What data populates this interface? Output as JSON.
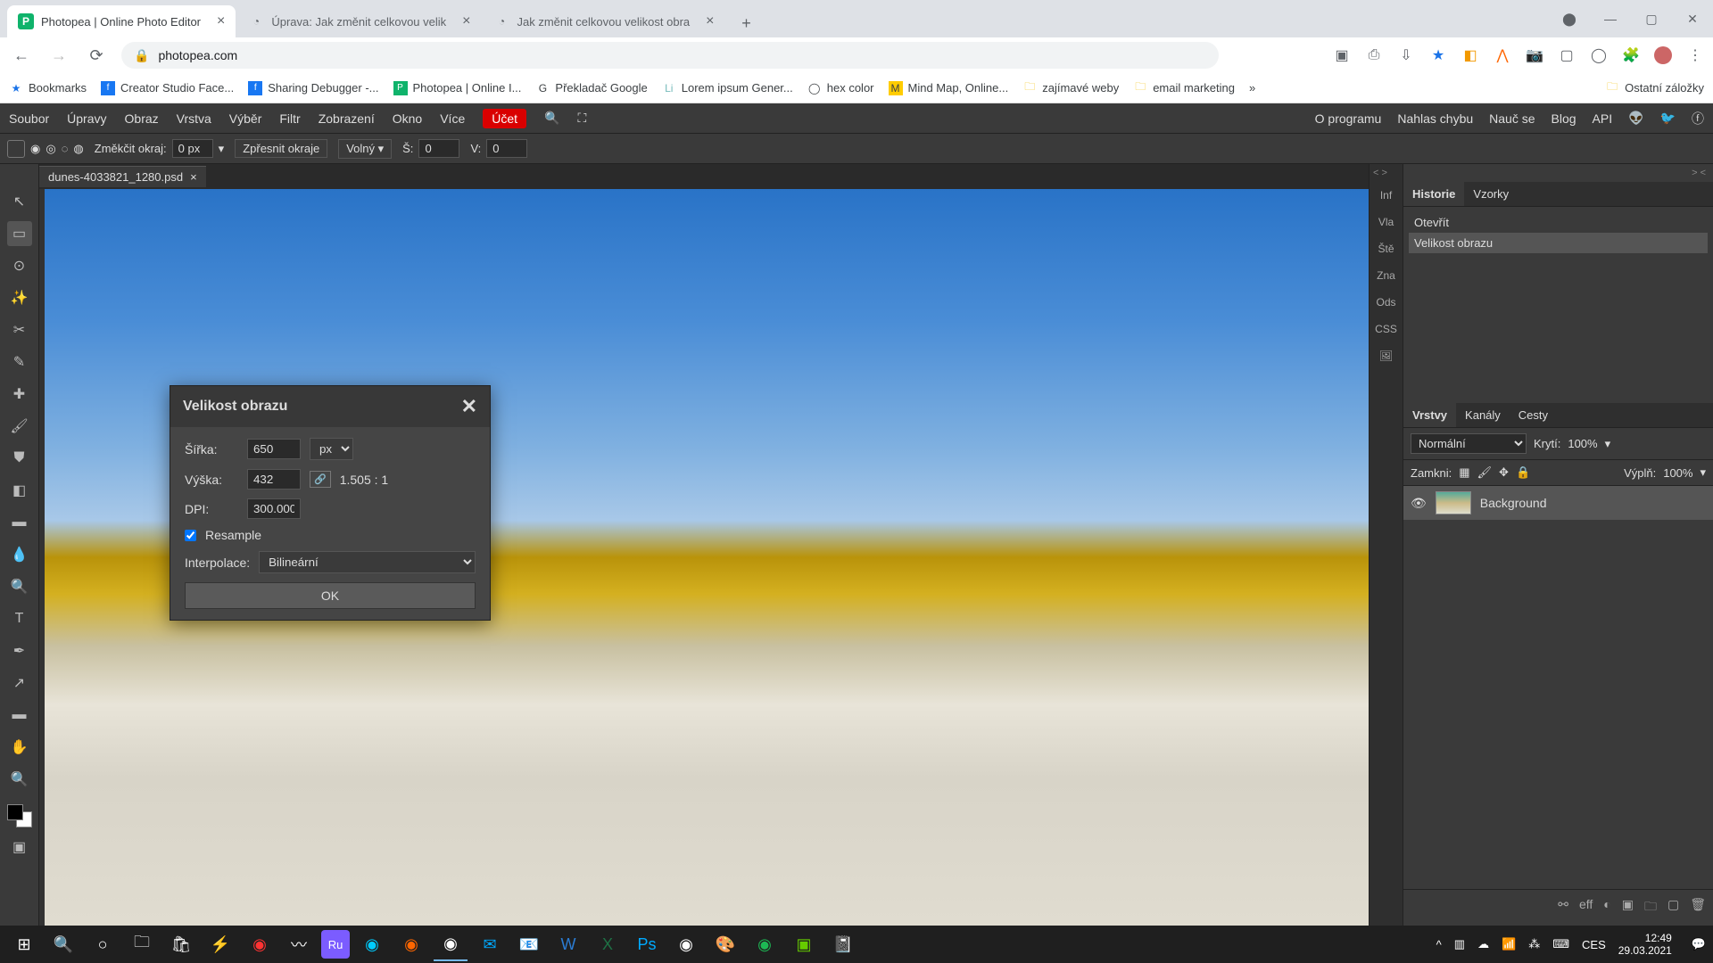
{
  "browser": {
    "tabs": [
      {
        "title": "Photopea | Online Photo Editor",
        "active": true
      },
      {
        "title": "Úprava: Jak změnit celkovou velik",
        "active": false
      },
      {
        "title": "Jak změnit celkovou velikost obra",
        "active": false
      }
    ],
    "url": "photopea.com",
    "bookmarks": {
      "first": "Bookmarks",
      "items": [
        "Creator Studio Face...",
        "Sharing Debugger -...",
        "Photopea | Online I...",
        "Překladač Google",
        "Lorem ipsum Gener...",
        "hex color",
        "Mind Map, Online...",
        "zajímavé weby",
        "email marketing"
      ],
      "more": "»",
      "other": "Ostatní záložky"
    }
  },
  "menubar": {
    "items": [
      "Soubor",
      "Úpravy",
      "Obraz",
      "Vrstva",
      "Výběr",
      "Filtr",
      "Zobrazení",
      "Okno",
      "Více"
    ],
    "account": "Účet",
    "right": [
      "O programu",
      "Nahlas chybu",
      "Nauč se",
      "Blog",
      "API"
    ]
  },
  "options": {
    "feather_label": "Změkčit okraj:",
    "feather_value": "0 px",
    "refine": "Zpřesnit okraje",
    "style": "Volný",
    "w_label": "Š:",
    "w_val": "0",
    "h_label": "V:",
    "h_val": "0"
  },
  "document": {
    "name": "dunes-4033821_1280.psd"
  },
  "dialog": {
    "title": "Velikost obrazu",
    "width_label": "Šířka:",
    "width_val": "650",
    "unit": "px",
    "height_label": "Výška:",
    "height_val": "432",
    "ratio": "1.505 : 1",
    "dpi_label": "DPI:",
    "dpi_val": "300.000",
    "resample": "Resample",
    "interp_label": "Interpolace:",
    "interp_val": "Bilineární",
    "ok": "OK"
  },
  "side_tabs": [
    "Inf",
    "Vla",
    "Ště",
    "Zna",
    "Ods",
    "CSS"
  ],
  "history": {
    "tabs": [
      "Historie",
      "Vzorky"
    ],
    "items": [
      {
        "label": "Otevřít",
        "sel": false
      },
      {
        "label": "Velikost obrazu",
        "sel": true
      }
    ]
  },
  "layers": {
    "tabs": [
      "Vrstvy",
      "Kanály",
      "Cesty"
    ],
    "blend": "Normální",
    "opacity_label": "Krytí:",
    "opacity_val": "100%",
    "lock_label": "Zamkni:",
    "fill_label": "Výplň:",
    "fill_val": "100%",
    "layer_name": "Background",
    "footer_eff": "eff"
  },
  "taskbar": {
    "lang": "CES",
    "time": "12:49",
    "date": "29.03.2021"
  }
}
